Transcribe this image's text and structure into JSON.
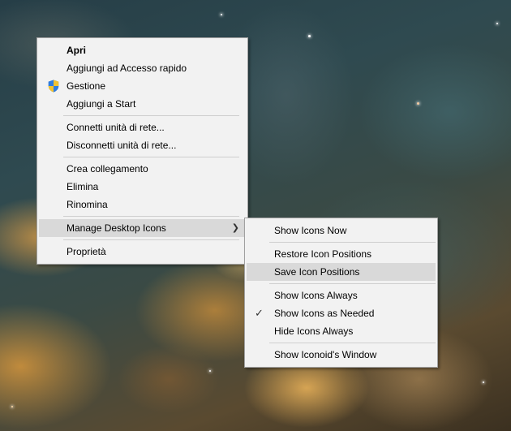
{
  "context_menu": {
    "groups": [
      [
        {
          "label": "Apri",
          "bold": true
        },
        {
          "label": "Aggiungi ad Accesso rapido"
        },
        {
          "label": "Gestione",
          "icon": "shield-icon"
        },
        {
          "label": "Aggiungi a Start"
        }
      ],
      [
        {
          "label": "Connetti unità di rete..."
        },
        {
          "label": "Disconnetti unità di rete..."
        }
      ],
      [
        {
          "label": "Crea collegamento"
        },
        {
          "label": "Elimina"
        },
        {
          "label": "Rinomina"
        }
      ],
      [
        {
          "label": "Manage Desktop Icons",
          "highlighted": true,
          "submenu_arrow": "chevron-right-icon"
        }
      ],
      [
        {
          "label": "Proprietà"
        }
      ]
    ]
  },
  "submenu": {
    "groups": [
      [
        {
          "label": "Show Icons Now"
        }
      ],
      [
        {
          "label": "Restore Icon Positions"
        },
        {
          "label": "Save Icon Positions",
          "highlighted": true
        }
      ],
      [
        {
          "label": "Show Icons Always"
        },
        {
          "label": "Show Icons as Needed",
          "checked": true
        },
        {
          "label": "Hide Icons Always"
        }
      ],
      [
        {
          "label": "Show Iconoid's Window"
        }
      ]
    ]
  },
  "colors": {
    "menu_background": "#f2f2f2",
    "menu_highlight": "#d9d9d9",
    "menu_border": "#a0a0a0"
  }
}
